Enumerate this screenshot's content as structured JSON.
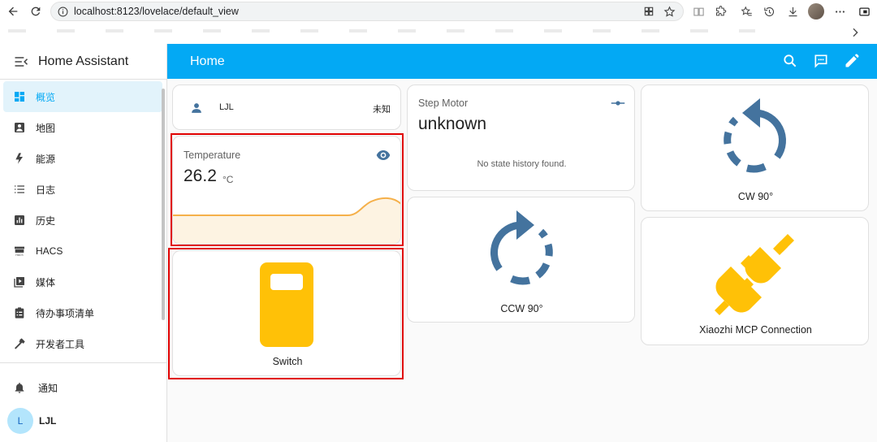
{
  "browser": {
    "url": "localhost:8123/lovelace/default_view"
  },
  "sidebar": {
    "title": "Home Assistant",
    "items": [
      {
        "label": "概览",
        "icon": "dashboard-icon",
        "active": true
      },
      {
        "label": "地图",
        "icon": "map-icon"
      },
      {
        "label": "能源",
        "icon": "lightning-bolt-icon"
      },
      {
        "label": "日志",
        "icon": "list-icon"
      },
      {
        "label": "历史",
        "icon": "chart-bar-icon"
      },
      {
        "label": "HACS",
        "icon": "hacs-icon"
      },
      {
        "label": "媒体",
        "icon": "media-play-icon"
      },
      {
        "label": "待办事项清单",
        "icon": "clipboard-list-icon"
      },
      {
        "label": "开发者工具",
        "icon": "hammer-icon"
      }
    ],
    "notifications_label": "通知",
    "user_initial": "L",
    "user_name": "LJL"
  },
  "header": {
    "title": "Home"
  },
  "cards": {
    "person": {
      "name": "LJL",
      "state": "未知"
    },
    "temperature": {
      "name": "Temperature",
      "value": "26.2",
      "unit": "°C"
    },
    "switch": {
      "name": "Switch"
    },
    "step_motor": {
      "name": "Step Motor",
      "state": "unknown",
      "history_message": "No state history found."
    },
    "ccw": {
      "name": "CCW 90°"
    },
    "cw": {
      "name": "CW 90°"
    },
    "mcp": {
      "name": "Xiaozhi MCP Connection"
    }
  },
  "colors": {
    "primary": "#03a9f4",
    "icon_blue": "#44739e",
    "switch_amber": "#ffc107",
    "graph_orange": "#f5b04a",
    "highlight_red": "#e00000"
  }
}
